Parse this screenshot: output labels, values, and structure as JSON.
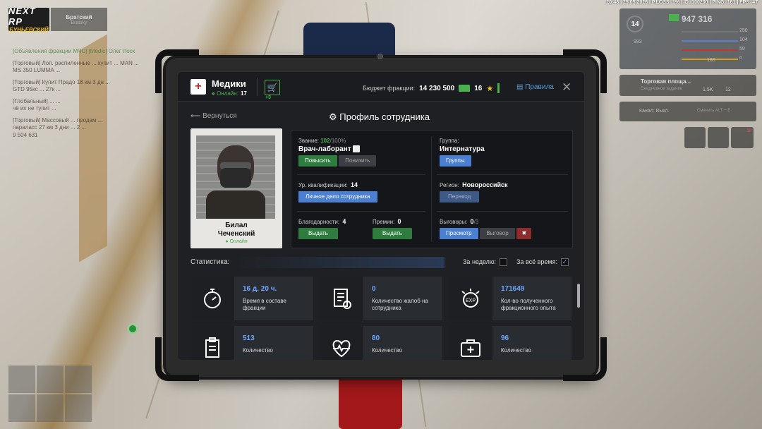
{
  "hud": {
    "top_status": "20:48 | 25.05.2026 | P.LOSS: 1% | ID: 100200 | PING: 161 | FPS: 47",
    "logo_line1": "NEXT RP",
    "logo_line2": "БУНЬЕВСКИЙ",
    "server_name": "Братский",
    "server_sub": "Bratsky",
    "level": "14",
    "money": "947 316",
    "stat_250": "250",
    "stat_104": "104",
    "stat_59": "59",
    "stat_0": "0",
    "stat_993": "993",
    "stat_188": "188",
    "market_title": "Торговая площа...",
    "market_sub": "Ежедневное задание",
    "market_val1": "1.5K",
    "market_val2": "12",
    "voice_label": "Канал: Выкл.",
    "voice_hint": "Сменить ALT + E",
    "notif_badge": "18",
    "chat_lines": [
      "[Объявления фракции МЧС] [Medic] Олег Лоск",
      "[Торговый] Лоп. распиленные ... купит ... MAN ...",
      "MS 350 LUMMA ...",
      "[Торговый] Купит Прадо 18 км 3 дн ...",
      "GTD 95кс ... 27к ...",
      "[Глобальный] ... ...",
      "чё их не тупит ...",
      "[Торговый] Массовый ... продам ...",
      "параласс 27 км 3 дни ... 2 ...",
      "9 504 631"
    ]
  },
  "header": {
    "faction_name": "Медики",
    "online_label": "Онлайн:",
    "online_count": "17",
    "cart_badge": "+3",
    "budget_label": "Бюджет фракции:",
    "budget_value": "14 230 500",
    "stars": "16",
    "rules_label": "Правила"
  },
  "nav": {
    "back_label": "Вернуться",
    "page_title": "Профиль сотрудника"
  },
  "employee": {
    "first_name": "Билал",
    "last_name": "Чеченский",
    "status": "Онлайн"
  },
  "profile": {
    "rank_label": "Звание:",
    "rank_value": "102",
    "rank_max": "/100%",
    "rank_title": "Врач-лаборант",
    "promote_btn": "Повысить",
    "demote_btn": "Понизить",
    "group_label": "Группа:",
    "group_value": "Интернатура",
    "groups_btn": "Группы",
    "qual_label": "Ур. квалификации:",
    "qual_value": "14",
    "file_btn": "Личное дело сотрудника",
    "region_label": "Регион:",
    "region_value": "Новороссийск",
    "transfer_btn": "Перевод",
    "thanks_label": "Благодарности:",
    "thanks_value": "4",
    "thanks_btn": "Выдать",
    "bonus_label": "Премии:",
    "bonus_value": "0",
    "bonus_btn": "Выдать",
    "reprimand_label": "Выговоры:",
    "reprimand_value": "0",
    "reprimand_max": "/3",
    "view_btn": "Просмотр",
    "reprimand_btn": "Выговор"
  },
  "stats": {
    "title": "Статистика:",
    "week_label": "За неделю:",
    "all_label": "За всё время:",
    "all_checked": "✓",
    "cards": [
      {
        "value": "16 д. 20 ч.",
        "desc": "Время в составе фракции",
        "icon": "stopwatch-icon"
      },
      {
        "value": "0",
        "desc": "Количество жалоб на сотрудника",
        "icon": "complaint-doc-icon"
      },
      {
        "value": "171649",
        "desc": "Кол-во полученного фракционного опыта",
        "icon": "exp-badge-icon"
      },
      {
        "value": "513",
        "desc": "Количество",
        "icon": "clipboard-icon"
      },
      {
        "value": "80",
        "desc": "Количество",
        "icon": "heart-pulse-icon"
      },
      {
        "value": "96",
        "desc": "Количество",
        "icon": "medkit-icon"
      }
    ]
  },
  "colors": {
    "accent_green": "#4caf50",
    "accent_blue": "#4a7fd1",
    "stat_number": "#6ea7ff",
    "panel_bg": "#1e2023"
  }
}
